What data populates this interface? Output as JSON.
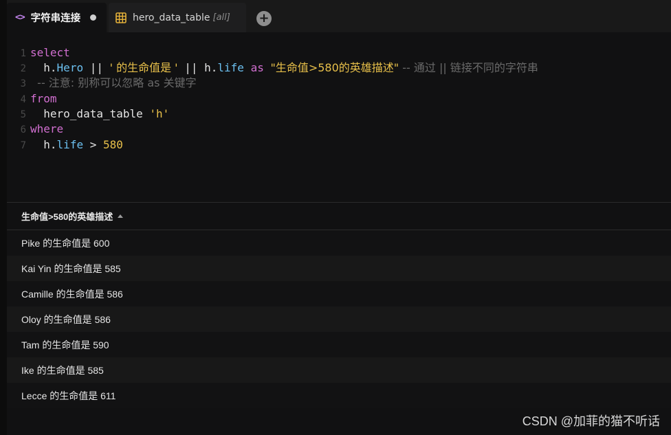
{
  "tabs": [
    {
      "label": "字符串连接",
      "icon": "code-icon",
      "icon_glyph": "<>",
      "unsaved": true
    },
    {
      "label": "hero_data_table",
      "filter": "[all]",
      "icon": "table-icon"
    }
  ],
  "add_tab_glyph": "+",
  "editor": {
    "line_numbers": [
      "1",
      "2",
      "3",
      "4",
      "5",
      "6",
      "7"
    ],
    "l1": {
      "kw": "select"
    },
    "l2": {
      "indent": "  ",
      "h1": "h",
      "dot1": ".",
      "f1": "Hero",
      "op1": " || ",
      "s1": "' 的生命值是 '",
      "op2": " || ",
      "h2": "h",
      "dot2": ".",
      "f2": "life",
      "as": " as ",
      "s2": "\"生命值>580的英雄描述\"",
      "c": " -- 通过 || 链接不同的字符串"
    },
    "l3": {
      "c": "  -- 注意: 别称可以忽略 as 关键字"
    },
    "l4": {
      "kw": "from"
    },
    "l5": {
      "t": "  hero_data_table ",
      "s": "'h'"
    },
    "l6": {
      "kw": "where"
    },
    "l7": {
      "indent": "  ",
      "h": "h",
      "dot": ".",
      "f": "life",
      "op": " > ",
      "n": "580"
    }
  },
  "results": {
    "column": "生命值>580的英雄描述",
    "rows": [
      "Pike 的生命值是 600",
      "Kai Yin 的生命值是 585",
      "Camille 的生命值是 586",
      "Oloy 的生命值是 586",
      "Tam 的生命值是 590",
      "Ike 的生命值是 585",
      "Lecce 的生命值是 611"
    ]
  },
  "watermark": "CSDN @加菲的猫不听话",
  "colors": {
    "keyword": "#d16fd0",
    "field": "#6cc0f0",
    "string": "#e8c04a",
    "comment": "#6a6a6a",
    "table_icon": "#e8b43a"
  }
}
